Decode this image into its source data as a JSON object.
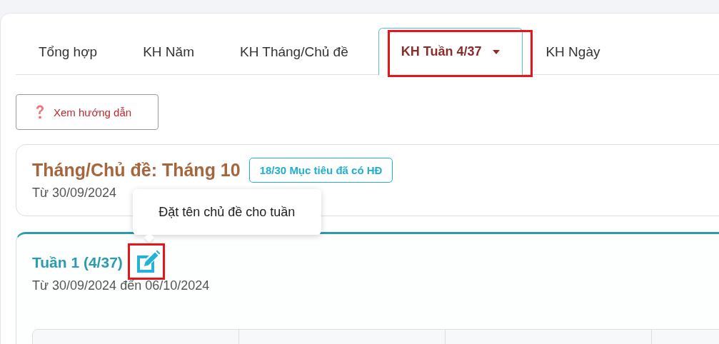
{
  "tabs": [
    {
      "label": "Tổng hợp",
      "selected": false,
      "dropdown": false,
      "highlighted": false
    },
    {
      "label": "KH Năm",
      "selected": false,
      "dropdown": false,
      "highlighted": false
    },
    {
      "label": "KH Tháng/Chủ đề",
      "selected": false,
      "dropdown": false,
      "highlighted": false
    },
    {
      "label": "KH Tuần 4/37",
      "selected": true,
      "dropdown": true,
      "highlighted": true
    },
    {
      "label": "KH Ngày",
      "selected": false,
      "dropdown": false,
      "highlighted": false
    }
  ],
  "guide_button": {
    "label": "Xem hướng dẫn"
  },
  "month_card": {
    "title": "Tháng/Chủ đề: Tháng 10",
    "badge": "18/30 Mục tiêu đã có HĐ",
    "date_range": "Từ 30/09/2024"
  },
  "tooltip": {
    "text": "Đặt tên chủ đề cho tuần"
  },
  "week_card": {
    "title": "Tuần 1 (4/37)",
    "edit_highlighted": true,
    "date_range": "Từ 30/09/2024 đến 06/10/2024"
  }
}
